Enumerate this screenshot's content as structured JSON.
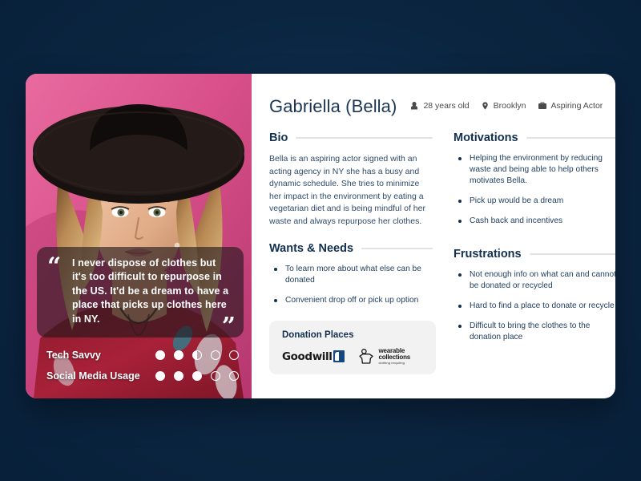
{
  "theme": {
    "page_background": "#0c2a45",
    "card_background": "#ffffff",
    "photo_panel_accent": "#e2588f",
    "heading_color": "#12304f",
    "body_text_color": "#22405f",
    "rule_color": "#e2e2e2",
    "donation_box_background": "#f2f2f2"
  },
  "persona": {
    "name": "Gabriella (Bella)",
    "meta": [
      {
        "icon": "person-icon",
        "label": "28 years old"
      },
      {
        "icon": "location-pin-icon",
        "label": "Brooklyn"
      },
      {
        "icon": "briefcase-icon",
        "label": "Aspiring Actor"
      }
    ]
  },
  "photo": {
    "alt": "Portrait of a young woman wearing a black wide-brim hat",
    "quote": "I never dispose of clothes but it's too difficult to repurpose in the US. It'd be a dream to have a place that picks up clothes here in NY.",
    "quote_open_mark": "“",
    "quote_close_mark": "”",
    "ratings": [
      {
        "label": "Tech Savvy",
        "states": [
          "full",
          "full",
          "half",
          "empty",
          "empty"
        ],
        "max": 5,
        "value": 2.5
      },
      {
        "label": "Social Media Usage",
        "states": [
          "full",
          "full",
          "full",
          "empty",
          "empty"
        ],
        "max": 5,
        "value": 3
      }
    ]
  },
  "sections": {
    "bio": {
      "title": "Bio",
      "text": "Bella is an aspiring actor signed with an acting agency in NY she has a busy and dynamic schedule. She tries to minimize her impact in the environment by eating a vegetarian diet and is being mindful of her waste and always repurpose her clothes."
    },
    "wants_needs": {
      "title": "Wants & Needs",
      "items": [
        "To learn more about what else can be donated",
        "Convenient drop off or pick up option"
      ]
    },
    "motivations": {
      "title": "Motivations",
      "items": [
        "Helping the environment by reducing waste and being able to help others motivates Bella.",
        "Pick up would be a dream",
        "Cash back and incentives"
      ]
    },
    "frustrations": {
      "title": "Frustrations",
      "items": [
        "Not enough info on what can and cannot be donated or recycled",
        "Hard to find a place to donate or recycle",
        "Difficult to bring the clothes to the donation place"
      ]
    },
    "donation_places": {
      "title": "Donation Places",
      "logos": [
        {
          "name": "goodwill-logo",
          "text": "Goodwill"
        },
        {
          "name": "wearable-collections-logo",
          "line1": "wearable",
          "line2": "collections",
          "line3": "clothing recycling"
        }
      ]
    }
  }
}
